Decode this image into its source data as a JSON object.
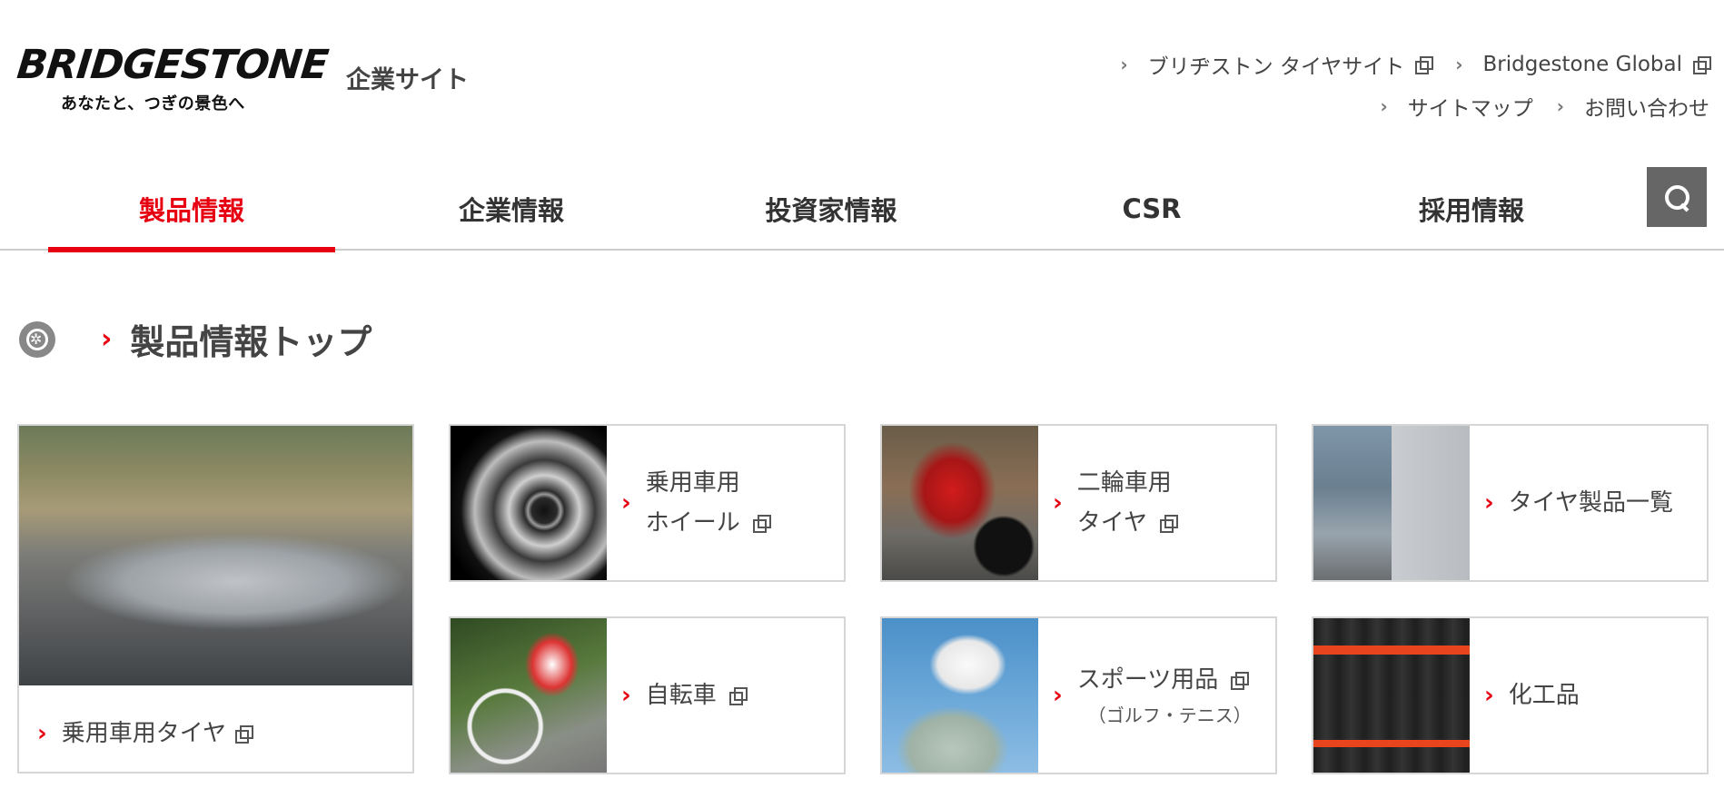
{
  "header": {
    "logo_text": "BRIDGESTONE",
    "tagline": "あなたと、つぎの景色へ",
    "site_label": "企業サイト",
    "util_links_row1": [
      {
        "label": "ブリヂストン タイヤサイト",
        "external": true
      },
      {
        "label": "Bridgestone Global",
        "external": true
      }
    ],
    "util_links_row2": [
      {
        "label": "サイトマップ",
        "external": false
      },
      {
        "label": "お問い合わせ",
        "external": false
      }
    ]
  },
  "nav": {
    "items": [
      {
        "label": "製品情報",
        "active": true
      },
      {
        "label": "企業情報",
        "active": false
      },
      {
        "label": "投資家情報",
        "active": false
      },
      {
        "label": "CSR",
        "active": false
      },
      {
        "label": "採用情報",
        "active": false
      }
    ],
    "search_icon": "search-icon"
  },
  "page": {
    "title": "製品情報トップ"
  },
  "cards": [
    {
      "line1": "乗用車用タイヤ",
      "external": true,
      "photo": "car"
    },
    {
      "line1": "乗用車用",
      "line2": "ホイール",
      "external": true,
      "photo": "wheel"
    },
    {
      "line1": "二輪車用",
      "line2": "タイヤ",
      "external": true,
      "photo": "motorcycle"
    },
    {
      "line1": "タイヤ製品一覧",
      "external": false,
      "photo": "truck"
    },
    {
      "line1": "自転車",
      "external": true,
      "photo": "bicycle"
    },
    {
      "line1": "スポーツ用品",
      "sub": "（ゴルフ・テニス）",
      "external": true,
      "photo": "golf"
    },
    {
      "line1": "化工品",
      "external": false,
      "photo": "chemical"
    }
  ],
  "colors": {
    "accent": "#e60012",
    "nav_text": "#333333",
    "search_bg": "#666666",
    "card_border": "#d6d6d6"
  }
}
